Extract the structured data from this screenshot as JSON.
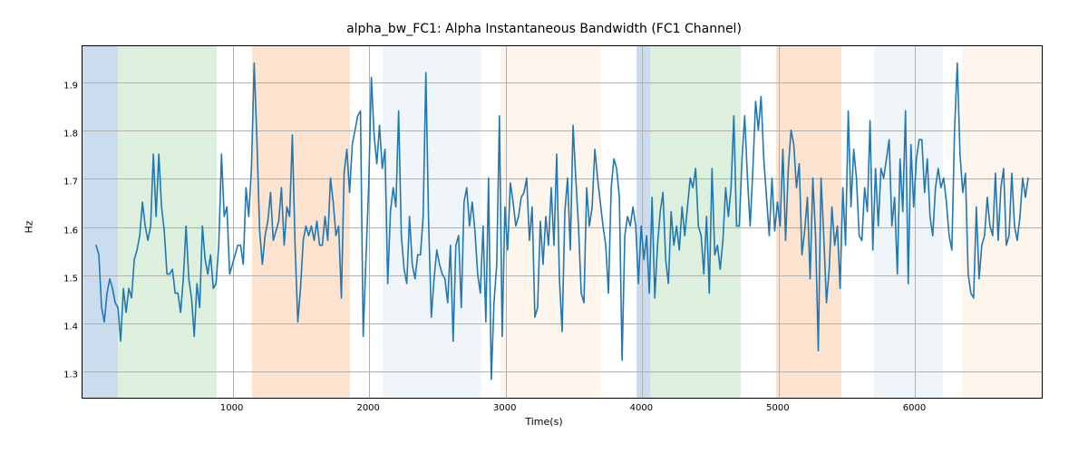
{
  "chart_data": {
    "type": "line",
    "title": "alpha_bw_FC1: Alpha Instantaneous Bandwidth (FC1 Channel)",
    "xlabel": "Time(s)",
    "ylabel": "Hz",
    "xlim": [
      -100,
      6940
    ],
    "ylim": [
      1.242,
      1.975
    ],
    "xticks": [
      1000,
      2000,
      3000,
      4000,
      5000,
      6000
    ],
    "yticks": [
      1.3,
      1.4,
      1.5,
      1.6,
      1.7,
      1.8,
      1.9
    ],
    "xtick_labels": [
      "1000",
      "2000",
      "3000",
      "4000",
      "5000",
      "6000"
    ],
    "ytick_labels": [
      "1.3",
      "1.4",
      "1.5",
      "1.6",
      "1.7",
      "1.8",
      "1.9"
    ],
    "shaded_regions": [
      {
        "start": -100,
        "end": 160,
        "color": "#6c9bd1"
      },
      {
        "start": 160,
        "end": 880,
        "color": "#9ed49e"
      },
      {
        "start": 1140,
        "end": 1860,
        "color": "#f5b178"
      },
      {
        "start": 2100,
        "end": 2820,
        "color": "#d5e3f0"
      },
      {
        "start": 2960,
        "end": 3700,
        "color": "#fbe1c8"
      },
      {
        "start": 3960,
        "end": 4060,
        "color": "#6c9bd1"
      },
      {
        "start": 4060,
        "end": 4720,
        "color": "#9ed49e"
      },
      {
        "start": 4980,
        "end": 5460,
        "color": "#f5b178"
      },
      {
        "start": 5700,
        "end": 6200,
        "color": "#d5e3f0"
      },
      {
        "start": 6340,
        "end": 6940,
        "color": "#fbe1c8"
      }
    ],
    "x": [
      0,
      20,
      40,
      60,
      80,
      100,
      120,
      140,
      160,
      180,
      200,
      220,
      240,
      260,
      280,
      300,
      320,
      340,
      360,
      380,
      400,
      420,
      440,
      460,
      480,
      500,
      520,
      540,
      560,
      580,
      600,
      620,
      640,
      660,
      680,
      700,
      720,
      740,
      760,
      780,
      800,
      820,
      840,
      860,
      880,
      900,
      920,
      940,
      960,
      980,
      1000,
      1020,
      1040,
      1060,
      1080,
      1100,
      1120,
      1140,
      1160,
      1180,
      1200,
      1220,
      1240,
      1260,
      1280,
      1300,
      1320,
      1340,
      1360,
      1380,
      1400,
      1420,
      1440,
      1460,
      1480,
      1500,
      1520,
      1540,
      1560,
      1580,
      1600,
      1620,
      1640,
      1660,
      1680,
      1700,
      1720,
      1740,
      1760,
      1780,
      1800,
      1820,
      1840,
      1860,
      1880,
      1900,
      1920,
      1940,
      1960,
      1980,
      2000,
      2020,
      2040,
      2060,
      2080,
      2100,
      2120,
      2140,
      2160,
      2180,
      2200,
      2220,
      2240,
      2260,
      2280,
      2300,
      2320,
      2340,
      2360,
      2380,
      2400,
      2420,
      2440,
      2460,
      2480,
      2500,
      2520,
      2540,
      2560,
      2580,
      2600,
      2620,
      2640,
      2660,
      2680,
      2700,
      2720,
      2740,
      2760,
      2780,
      2800,
      2820,
      2840,
      2860,
      2880,
      2900,
      2920,
      2940,
      2960,
      2980,
      3000,
      3020,
      3040,
      3060,
      3080,
      3100,
      3120,
      3140,
      3160,
      3180,
      3200,
      3220,
      3240,
      3260,
      3280,
      3300,
      3320,
      3340,
      3360,
      3380,
      3400,
      3420,
      3440,
      3460,
      3480,
      3500,
      3520,
      3540,
      3560,
      3580,
      3600,
      3620,
      3640,
      3660,
      3680,
      3700,
      3720,
      3740,
      3760,
      3780,
      3800,
      3820,
      3840,
      3860,
      3880,
      3900,
      3920,
      3940,
      3960,
      3980,
      4000,
      4020,
      4040,
      4060,
      4080,
      4100,
      4120,
      4140,
      4160,
      4180,
      4200,
      4220,
      4240,
      4260,
      4280,
      4300,
      4320,
      4340,
      4360,
      4380,
      4400,
      4420,
      4440,
      4460,
      4480,
      4500,
      4520,
      4540,
      4560,
      4580,
      4600,
      4620,
      4640,
      4660,
      4680,
      4700,
      4720,
      4740,
      4760,
      4780,
      4800,
      4820,
      4840,
      4860,
      4880,
      4900,
      4920,
      4940,
      4960,
      4980,
      5000,
      5020,
      5040,
      5060,
      5080,
      5100,
      5120,
      5140,
      5160,
      5180,
      5200,
      5220,
      5240,
      5260,
      5280,
      5300,
      5320,
      5340,
      5360,
      5380,
      5400,
      5420,
      5440,
      5460,
      5480,
      5500,
      5520,
      5540,
      5560,
      5580,
      5600,
      5620,
      5640,
      5660,
      5680,
      5700,
      5720,
      5740,
      5760,
      5780,
      5800,
      5820,
      5840,
      5860,
      5880,
      5900,
      5920,
      5940,
      5960,
      5980,
      6000,
      6020,
      6040,
      6060,
      6080,
      6100,
      6120,
      6140,
      6160,
      6180,
      6200,
      6220,
      6240,
      6260,
      6280,
      6300,
      6320,
      6340,
      6360,
      6380,
      6400,
      6420,
      6440,
      6460,
      6480,
      6500,
      6520,
      6540,
      6560,
      6580,
      6600,
      6620,
      6640,
      6660,
      6680,
      6700,
      6720,
      6740,
      6760,
      6780,
      6800,
      6820,
      6840
    ],
    "values": [
      1.56,
      1.54,
      1.43,
      1.4,
      1.46,
      1.49,
      1.47,
      1.44,
      1.43,
      1.36,
      1.47,
      1.42,
      1.47,
      1.45,
      1.53,
      1.55,
      1.58,
      1.65,
      1.6,
      1.57,
      1.6,
      1.75,
      1.62,
      1.75,
      1.64,
      1.59,
      1.5,
      1.5,
      1.51,
      1.46,
      1.46,
      1.42,
      1.49,
      1.6,
      1.49,
      1.45,
      1.37,
      1.48,
      1.43,
      1.6,
      1.53,
      1.5,
      1.54,
      1.47,
      1.48,
      1.56,
      1.75,
      1.62,
      1.64,
      1.5,
      1.52,
      1.54,
      1.56,
      1.56,
      1.52,
      1.68,
      1.62,
      1.72,
      1.94,
      1.78,
      1.59,
      1.52,
      1.58,
      1.61,
      1.67,
      1.57,
      1.59,
      1.61,
      1.68,
      1.56,
      1.64,
      1.62,
      1.79,
      1.56,
      1.4,
      1.47,
      1.57,
      1.6,
      1.58,
      1.6,
      1.57,
      1.61,
      1.56,
      1.56,
      1.62,
      1.57,
      1.7,
      1.65,
      1.58,
      1.6,
      1.45,
      1.71,
      1.76,
      1.67,
      1.77,
      1.8,
      1.83,
      1.84,
      1.37,
      1.53,
      1.68,
      1.91,
      1.79,
      1.73,
      1.81,
      1.72,
      1.76,
      1.48,
      1.63,
      1.68,
      1.64,
      1.84,
      1.58,
      1.51,
      1.48,
      1.62,
      1.52,
      1.49,
      1.54,
      1.54,
      1.62,
      1.92,
      1.61,
      1.41,
      1.49,
      1.55,
      1.52,
      1.5,
      1.49,
      1.44,
      1.56,
      1.36,
      1.56,
      1.58,
      1.43,
      1.65,
      1.68,
      1.6,
      1.65,
      1.59,
      1.5,
      1.46,
      1.6,
      1.4,
      1.7,
      1.28,
      1.44,
      1.52,
      1.83,
      1.37,
      1.64,
      1.55,
      1.69,
      1.65,
      1.6,
      1.62,
      1.66,
      1.67,
      1.7,
      1.57,
      1.64,
      1.41,
      1.43,
      1.61,
      1.52,
      1.62,
      1.56,
      1.68,
      1.56,
      1.75,
      1.49,
      1.38,
      1.63,
      1.7,
      1.55,
      1.81,
      1.7,
      1.6,
      1.46,
      1.44,
      1.68,
      1.6,
      1.64,
      1.76,
      1.7,
      1.65,
      1.6,
      1.56,
      1.46,
      1.68,
      1.74,
      1.72,
      1.66,
      1.32,
      1.58,
      1.62,
      1.6,
      1.64,
      1.6,
      1.48,
      1.6,
      1.53,
      1.58,
      1.46,
      1.66,
      1.45,
      1.56,
      1.63,
      1.67,
      1.53,
      1.48,
      1.63,
      1.56,
      1.6,
      1.55,
      1.64,
      1.58,
      1.64,
      1.7,
      1.68,
      1.72,
      1.6,
      1.58,
      1.5,
      1.62,
      1.46,
      1.72,
      1.54,
      1.56,
      1.51,
      1.57,
      1.68,
      1.62,
      1.68,
      1.83,
      1.6,
      1.6,
      1.74,
      1.83,
      1.7,
      1.6,
      1.72,
      1.86,
      1.8,
      1.87,
      1.74,
      1.66,
      1.58,
      1.7,
      1.59,
      1.65,
      1.6,
      1.76,
      1.57,
      1.72,
      1.8,
      1.77,
      1.68,
      1.73,
      1.54,
      1.59,
      1.66,
      1.49,
      1.7,
      1.58,
      1.34,
      1.7,
      1.58,
      1.44,
      1.51,
      1.64,
      1.56,
      1.6,
      1.47,
      1.68,
      1.56,
      1.84,
      1.64,
      1.76,
      1.7,
      1.58,
      1.57,
      1.68,
      1.63,
      1.82,
      1.55,
      1.72,
      1.6,
      1.72,
      1.7,
      1.74,
      1.78,
      1.6,
      1.66,
      1.5,
      1.74,
      1.63,
      1.84,
      1.48,
      1.77,
      1.64,
      1.74,
      1.78,
      1.78,
      1.67,
      1.74,
      1.62,
      1.58,
      1.68,
      1.72,
      1.68,
      1.7,
      1.65,
      1.58,
      1.55,
      1.8,
      1.94,
      1.75,
      1.67,
      1.71,
      1.5,
      1.46,
      1.45,
      1.64,
      1.49,
      1.56,
      1.58,
      1.66,
      1.6,
      1.58,
      1.71,
      1.57,
      1.68,
      1.72,
      1.56,
      1.58,
      1.71,
      1.6,
      1.57,
      1.62,
      1.7,
      1.66,
      1.7
    ]
  }
}
